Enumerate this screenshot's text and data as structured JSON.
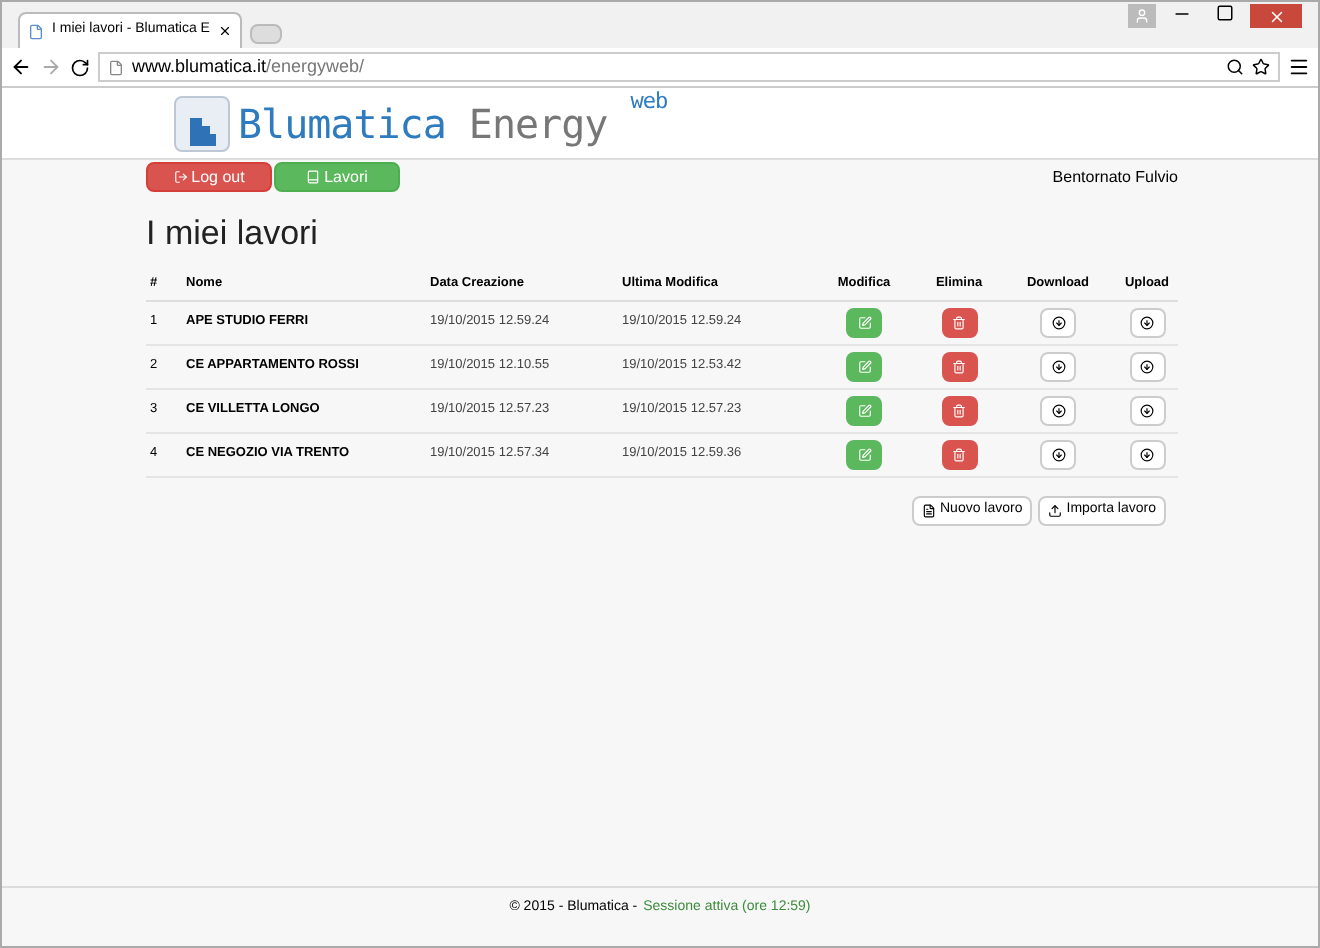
{
  "browser": {
    "tab_title": "I miei lavori - Blumatica E",
    "url_host": "www.blumatica.it",
    "url_path": "/energyweb/"
  },
  "logo": {
    "brand": "Blumatica",
    "product": "Energy",
    "suffix": "web"
  },
  "nav": {
    "buttons": [
      {
        "label": "Log out",
        "kind": "logout"
      },
      {
        "label": "Lavori",
        "kind": "works"
      }
    ],
    "greeting": "Bentornato Fulvio"
  },
  "title": "I miei lavori",
  "table": {
    "columns": [
      "#",
      "Nome",
      "Data Creazione",
      "Ultima Modifica",
      "Modifica",
      "Elimina",
      "Download",
      "Upload"
    ],
    "rows": [
      {
        "n": "1",
        "name": "APE STUDIO FERRI",
        "created": "19/10/2015 12.59.24",
        "modified": "19/10/2015 12.59.24"
      },
      {
        "n": "2",
        "name": "CE APPARTAMENTO ROSSI",
        "created": "19/10/2015 12.10.55",
        "modified": "19/10/2015 12.53.42"
      },
      {
        "n": "3",
        "name": "CE VILLETTA LONGO",
        "created": "19/10/2015 12.57.23",
        "modified": "19/10/2015 12.57.23"
      },
      {
        "n": "4",
        "name": "CE NEGOZIO VIA TRENTO",
        "created": "19/10/2015 12.57.34",
        "modified": "19/10/2015 12.59.36"
      }
    ]
  },
  "actions": [
    {
      "label": "Nuovo lavoro",
      "kind": "new"
    },
    {
      "label": "Importa lavoro",
      "kind": "import"
    }
  ],
  "footer": {
    "copyright": "© 2015 - Blumatica -",
    "session": "Sessione attiva (ore 12:59)"
  }
}
